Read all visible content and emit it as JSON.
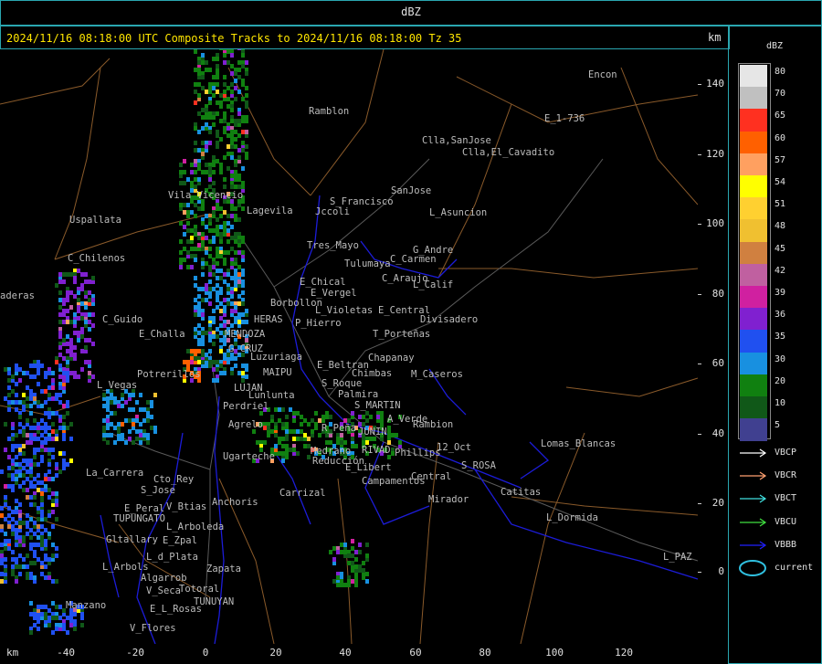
{
  "window": {
    "title": "dBZ"
  },
  "header": {
    "text": "2024/11/16 08:18:00 UTC Composite Tracks to 2024/11/16 08:18:00 Tz 35",
    "unit": "km"
  },
  "xaxis": {
    "unit": "km",
    "ticks": [
      "-40",
      "-20",
      "0",
      "20",
      "40",
      "60",
      "80",
      "100",
      "120"
    ]
  },
  "yaxis": {
    "ticks": [
      "140",
      "120",
      "100",
      "80",
      "60",
      "40",
      "20",
      "0"
    ]
  },
  "legend": {
    "title": "dBZ",
    "entries": [
      {
        "value": "80",
        "color": "#e6e6e6"
      },
      {
        "value": "70",
        "color": "#c0c0c0"
      },
      {
        "value": "65",
        "color": "#ff3020"
      },
      {
        "value": "60",
        "color": "#ff6000"
      },
      {
        "value": "57",
        "color": "#ffa060"
      },
      {
        "value": "54",
        "color": "#ffff00"
      },
      {
        "value": "51",
        "color": "#ffd030"
      },
      {
        "value": "48",
        "color": "#f0c030"
      },
      {
        "value": "45",
        "color": "#d08040"
      },
      {
        "value": "42",
        "color": "#c060a0"
      },
      {
        "value": "39",
        "color": "#d020a0"
      },
      {
        "value": "36",
        "color": "#8020d0"
      },
      {
        "value": "35",
        "color": "#2050f0"
      },
      {
        "value": "30",
        "color": "#1890e0"
      },
      {
        "value": "20",
        "color": "#108010"
      },
      {
        "value": "10",
        "color": "#105818"
      },
      {
        "value": "5",
        "color": "#404090"
      }
    ],
    "tracks": [
      {
        "label": "VBCP",
        "color": "#ffffff"
      },
      {
        "label": "VBCR",
        "color": "#ffa070"
      },
      {
        "label": "VBCT",
        "color": "#40e0e0"
      },
      {
        "label": "VBCU",
        "color": "#40e040"
      },
      {
        "label": "VBBB",
        "color": "#2020ff"
      },
      {
        "label": "current",
        "color": "#30c0e0"
      }
    ]
  },
  "places": [
    {
      "name": "Ramblon"
    },
    {
      "name": "Encon"
    },
    {
      "name": "E_1-736"
    },
    {
      "name": "Clla,SanJose"
    },
    {
      "name": "Clla,El_Cavadito"
    },
    {
      "name": "SanJose"
    },
    {
      "name": "S_Francisco"
    },
    {
      "name": "Jccoli"
    },
    {
      "name": "L_Asuncion"
    },
    {
      "name": "Uspallata"
    },
    {
      "name": "Vila Vicencio"
    },
    {
      "name": "Lagevila"
    },
    {
      "name": "Tres_Mayo"
    },
    {
      "name": "Tulumaya"
    },
    {
      "name": "G_Andre"
    },
    {
      "name": "C_Carmen"
    },
    {
      "name": "C_Chilenos"
    },
    {
      "name": "E_Chical"
    },
    {
      "name": "E_Vergel"
    },
    {
      "name": "C_Araujo"
    },
    {
      "name": "L_Calif"
    },
    {
      "name": "aderas"
    },
    {
      "name": "Borbollon"
    },
    {
      "name": "C_Guido"
    },
    {
      "name": "HERAS"
    },
    {
      "name": "P_Hierro"
    },
    {
      "name": "L_Violetas"
    },
    {
      "name": "E_Central"
    },
    {
      "name": "Divisadero"
    },
    {
      "name": "E_Challa"
    },
    {
      "name": "MENDOZA"
    },
    {
      "name": "T_Porteñas"
    },
    {
      "name": "G_CRUZ"
    },
    {
      "name": "Luzuriaga"
    },
    {
      "name": "Chapanay"
    },
    {
      "name": "Potrerillos"
    },
    {
      "name": "E_Beltran"
    },
    {
      "name": "Chimbas"
    },
    {
      "name": "M_Caseros"
    },
    {
      "name": "MAIPU"
    },
    {
      "name": "L_Vegas"
    },
    {
      "name": "LUJAN"
    },
    {
      "name": "S_Roque"
    },
    {
      "name": "Palmira"
    },
    {
      "name": "Lunlunta"
    },
    {
      "name": "S_MARTIN"
    },
    {
      "name": "Perdriel"
    },
    {
      "name": "A_Verde"
    },
    {
      "name": "Rambion"
    },
    {
      "name": "Agrelo"
    },
    {
      "name": "R_Peña"
    },
    {
      "name": "JUNIN"
    },
    {
      "name": "12_Oct"
    },
    {
      "name": "Lomas_Blancas"
    },
    {
      "name": "Medrano"
    },
    {
      "name": "RIVAD"
    },
    {
      "name": "Phillips"
    },
    {
      "name": "Ugarteche"
    },
    {
      "name": "Reducción"
    },
    {
      "name": "S_ROSA"
    },
    {
      "name": "E_Libert"
    },
    {
      "name": "La_Carrera"
    },
    {
      "name": "Central"
    },
    {
      "name": "Campamentos"
    },
    {
      "name": "Cto_Rey"
    },
    {
      "name": "S_Jose"
    },
    {
      "name": "Carrizal"
    },
    {
      "name": "Catitas"
    },
    {
      "name": "Mirador"
    },
    {
      "name": "Anchoris"
    },
    {
      "name": "E_Peral"
    },
    {
      "name": "V_Btias"
    },
    {
      "name": "TUPUNGATO"
    },
    {
      "name": "L_Dormida"
    },
    {
      "name": "L_Arboleda"
    },
    {
      "name": "Gltallary"
    },
    {
      "name": "E_Zpal"
    },
    {
      "name": "L_d_Plata"
    },
    {
      "name": "L_PAZ"
    },
    {
      "name": "L_Arbols"
    },
    {
      "name": "Zapata"
    },
    {
      "name": "Algarrob"
    },
    {
      "name": "Totoral"
    },
    {
      "name": "V_Seca"
    },
    {
      "name": "TUNUYAN"
    },
    {
      "name": "E_L_Rosas"
    },
    {
      "name": "Manzano"
    },
    {
      "name": "V_Flores"
    }
  ]
}
